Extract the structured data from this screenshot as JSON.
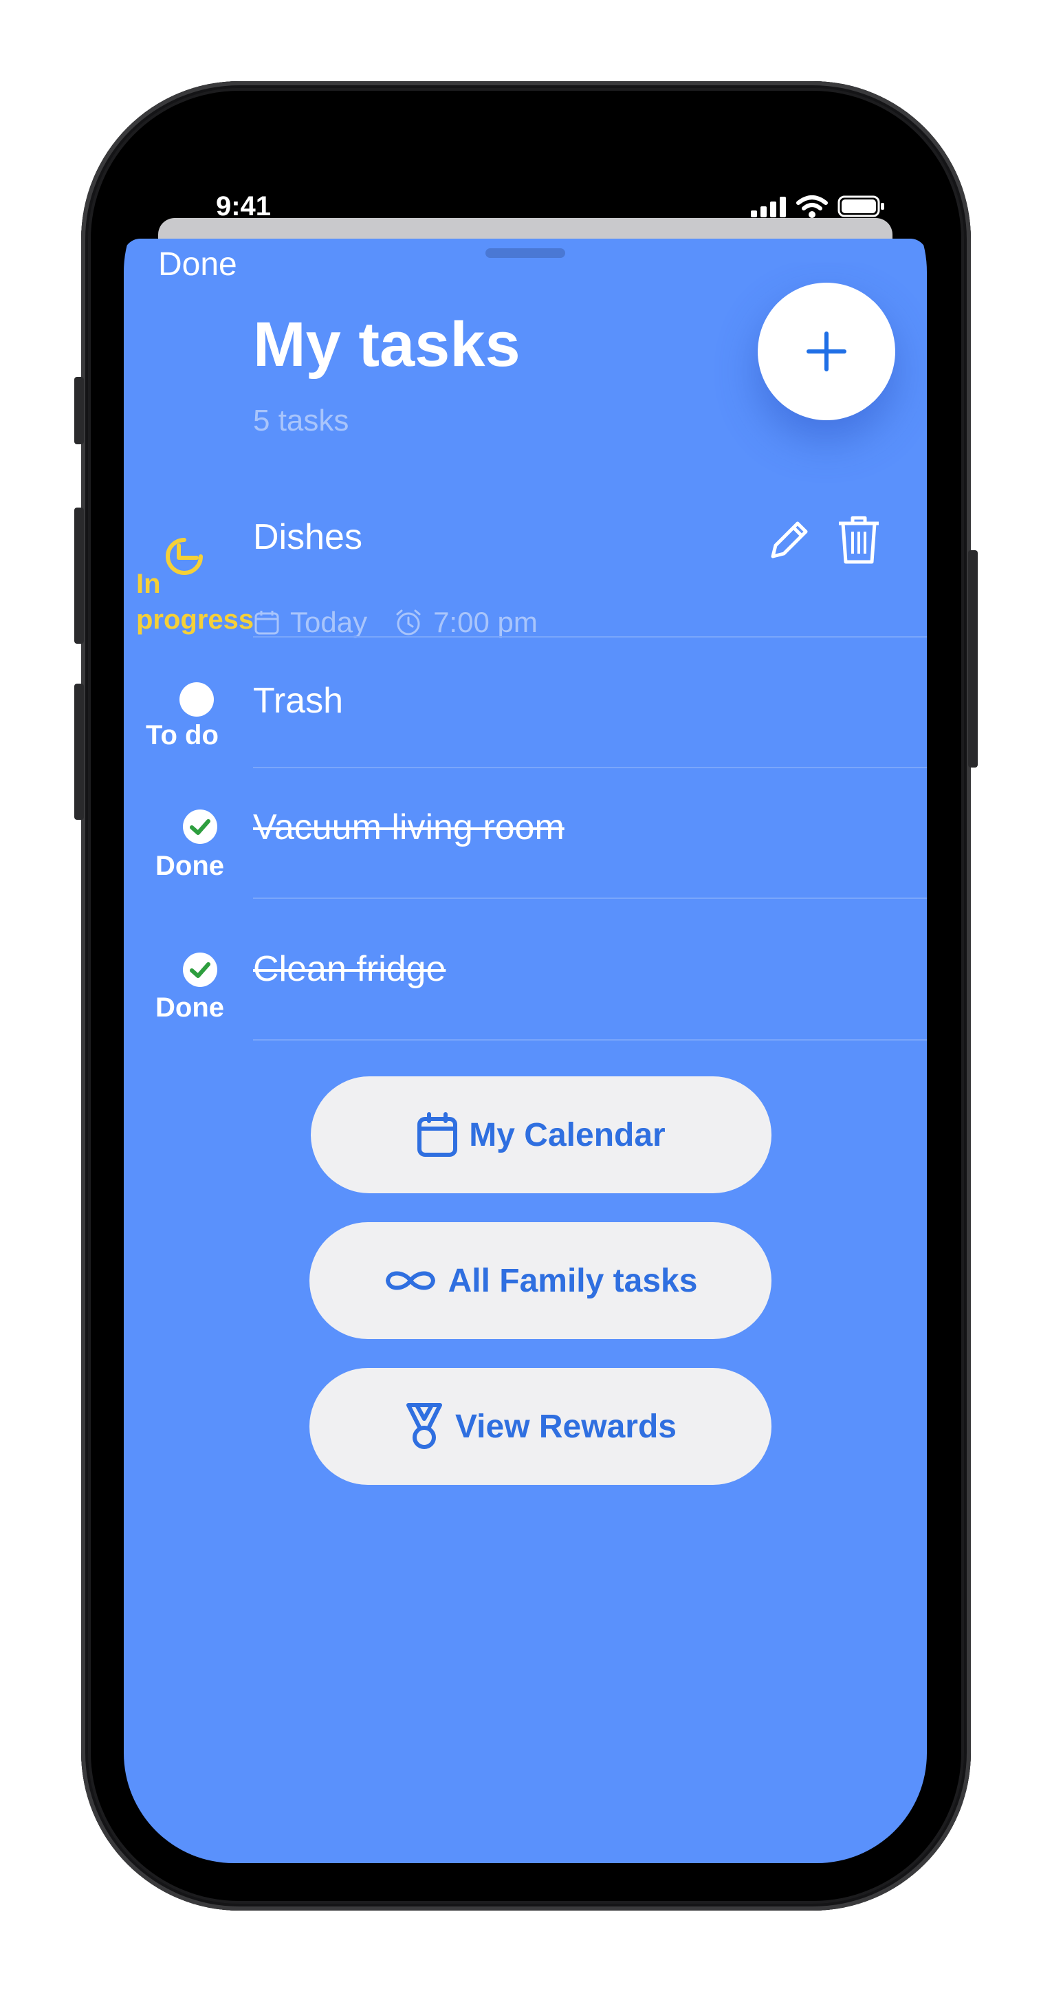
{
  "status_bar": {
    "time": "9:41"
  },
  "nav": {
    "done_label": "Done"
  },
  "header": {
    "title": "My tasks",
    "subtitle": "5 tasks",
    "add_icon": "plus-icon"
  },
  "tasks": [
    {
      "name": "Dishes",
      "status": "In progress",
      "status_color": "#f5d038",
      "date": "Today",
      "time": "7:00 pm",
      "completed": false
    },
    {
      "name": "Trash",
      "status": "To do",
      "status_color": "#ffffff",
      "completed": false
    },
    {
      "name": "Vacuum living room",
      "status": "Done",
      "status_color": "#ffffff",
      "completed": true
    },
    {
      "name": "Clean fridge",
      "status": "Done",
      "status_color": "#ffffff",
      "completed": true
    }
  ],
  "actions": [
    {
      "label": "My Calendar",
      "icon": "calendar-icon"
    },
    {
      "label": "All Family tasks",
      "icon": "infinity-icon"
    },
    {
      "label": "View Rewards",
      "icon": "medal-icon"
    }
  ],
  "colors": {
    "sheet": "#5a91fc",
    "accent": "#2f6fe0",
    "in_progress": "#f5d038",
    "check": "#2e9e3e"
  }
}
